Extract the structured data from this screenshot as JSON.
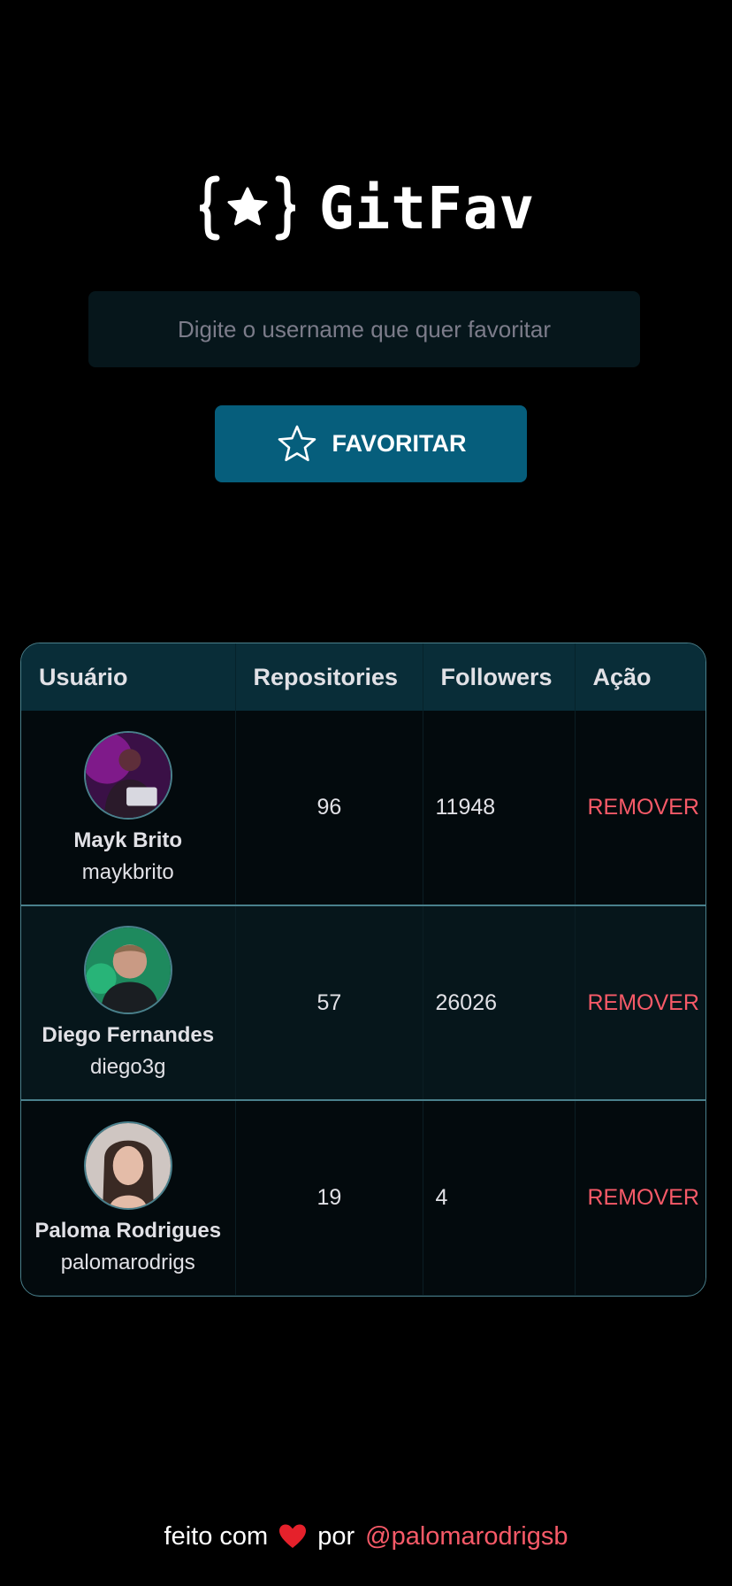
{
  "app": {
    "title": "GitFav"
  },
  "search": {
    "placeholder": "Digite o username que quer favoritar",
    "value": ""
  },
  "favorite_button": {
    "label": "FAVORITAR",
    "icon": "star-outline-icon"
  },
  "table": {
    "headers": [
      "Usuário",
      "Repositories",
      "Followers",
      "Ação"
    ],
    "rows": [
      {
        "name": "Mayk Brito",
        "login": "maykbrito",
        "repositories": "96",
        "followers": "11948",
        "action": "REMOVER"
      },
      {
        "name": "Diego Fernandes",
        "login": "diego3g",
        "repositories": "57",
        "followers": "26026",
        "action": "REMOVER"
      },
      {
        "name": "Paloma Rodrigues",
        "login": "palomarodrigs",
        "repositories": "19",
        "followers": "4",
        "action": "REMOVER"
      }
    ]
  },
  "footer": {
    "text_before": "feito com",
    "text_middle": "por",
    "link": "@palomarodrigsb",
    "icon": "heart-icon"
  },
  "colors": {
    "background": "#000000",
    "input_bg": "#06161B",
    "button_bg": "#065E7C",
    "header_bg": "#092D38",
    "border": "#4A808C",
    "remove": "#F75A68"
  }
}
